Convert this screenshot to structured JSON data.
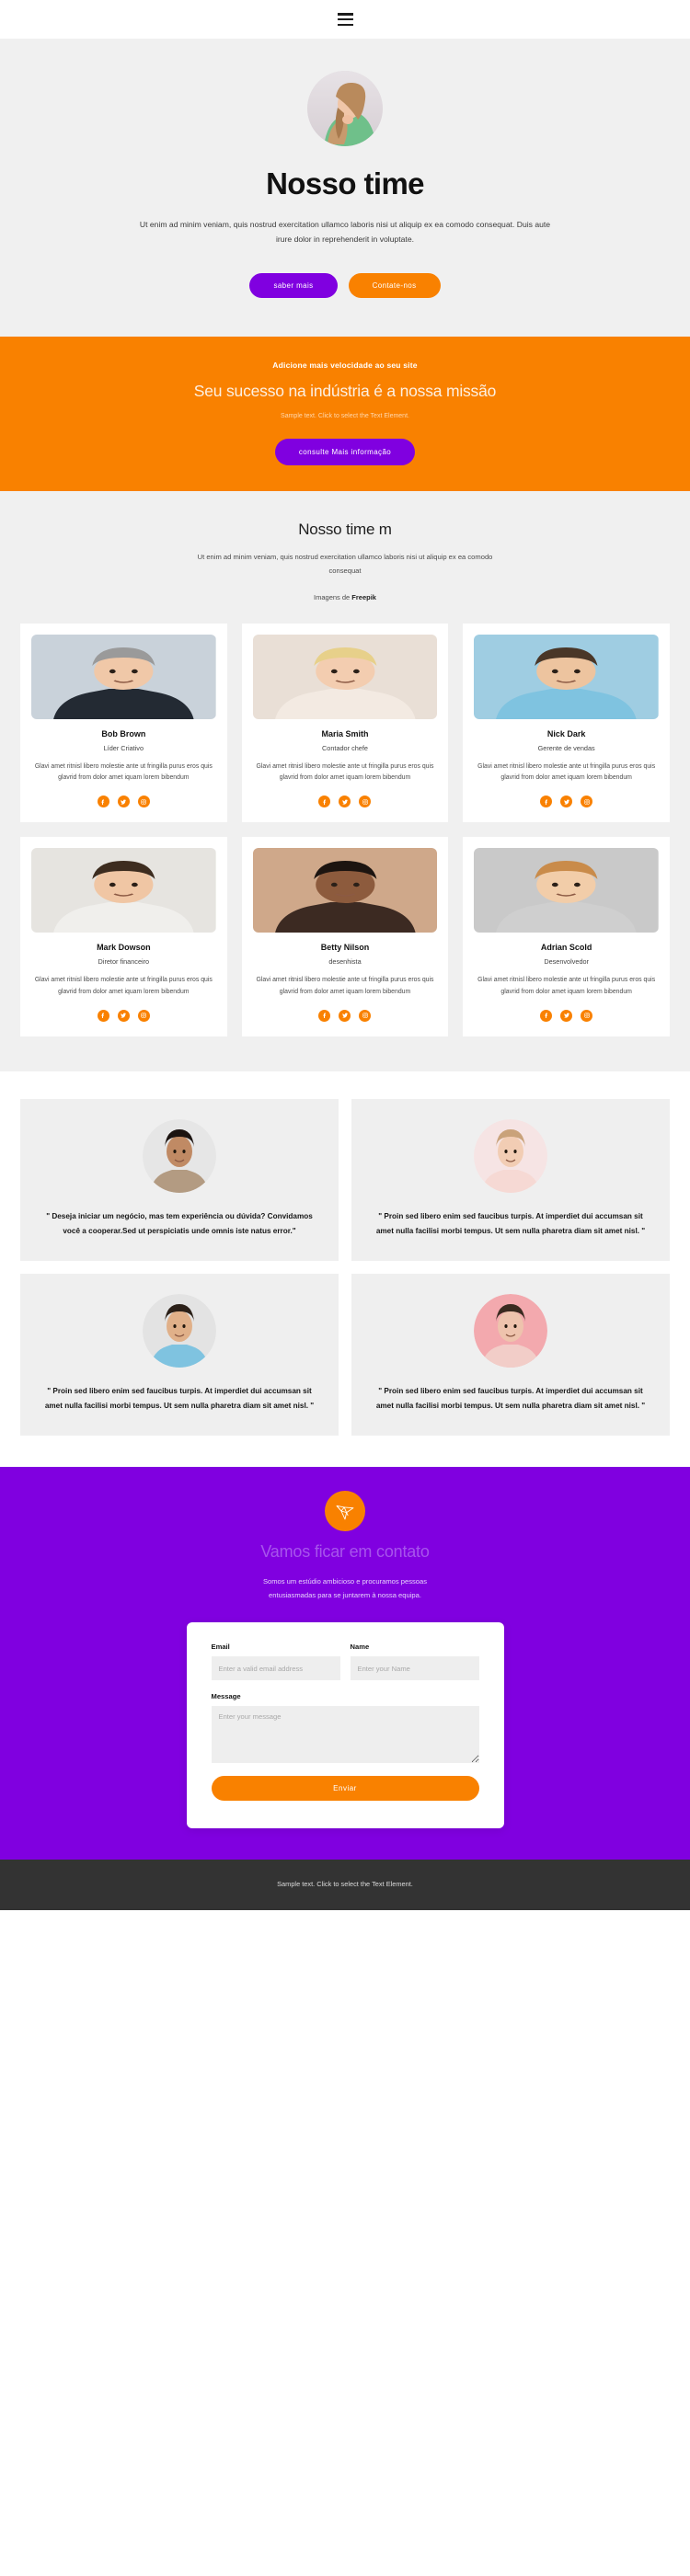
{
  "header": {
    "menu_icon": "hamburger-menu-icon"
  },
  "hero": {
    "avatar_alt": "woman-smiling-portrait",
    "title": "Nosso time",
    "subtitle": "Ut enim ad minim veniam, quis nostrud exercitation ullamco laboris nisi ut aliquip ex ea comodo consequat. Duis aute irure dolor in reprehenderit in voluptate.",
    "primary_button": "saber mais",
    "secondary_button": "Contate-nos"
  },
  "banner": {
    "kicker": "Adicione mais velocidade ao seu site",
    "title": "Seu sucesso na indústria é a nossa missão",
    "text": "Sample text. Click to select the Text Element.",
    "button": "consulte Mais informação"
  },
  "team": {
    "title": "Nosso time m",
    "subtitle": "Ut enim ad minim veniam, quis nostrud exercitation ullamco laboris nisi ut aliquip ex ea comodo consequat",
    "credit_prefix": "Imagens de ",
    "credit_source": "Freepik",
    "bio": "Glavi amet ritnisl libero molestie ante ut fringilla purus eros quis glavrid from dolor amet iquam lorem bibendum",
    "members": [
      {
        "name": "Bob Brown",
        "role": "Líder Criativo",
        "photo_top": "#2f3740",
        "photo_bottom": "#cfd6dc"
      },
      {
        "name": "Maria Smith",
        "role": "Contador chefe",
        "photo_top": "#d8c3b3",
        "photo_bottom": "#e9ded5"
      },
      {
        "name": "Nick Dark",
        "role": "Gerente de vendas",
        "photo_top": "#b9d9e8",
        "photo_bottom": "#8fc4de"
      },
      {
        "name": "Mark Dowson",
        "role": "Diretor financeiro",
        "photo_top": "#d9bda6",
        "photo_bottom": "#e8e6e3"
      },
      {
        "name": "Betty Nilson",
        "role": "desenhista",
        "photo_top": "#3b2a22",
        "photo_bottom": "#c9a98e"
      },
      {
        "name": "Adrian Scold",
        "role": "Desenvolvedor",
        "photo_top": "#c49a73",
        "photo_bottom": "#c9c9c9"
      }
    ],
    "socials": [
      "facebook-icon",
      "twitter-icon",
      "instagram-icon"
    ]
  },
  "testimonials": [
    {
      "avatar_bg": "#e6e6e6",
      "avatar_alt": "curly-hair-woman-portrait",
      "quote": "\" Deseja iniciar um negócio, mas tem experiência ou dúvida? Convidamos você a cooperar.Sed ut perspiciatis unde omnis iste natus error.\""
    },
    {
      "avatar_bg": "#f6e4e4",
      "avatar_alt": "woman-hand-on-face-portrait",
      "quote": "\" Proin sed libero enim sed faucibus turpis. At imperdiet dui accumsan sit amet nulla facilisi morbi tempus. Ut sem nulla pharetra diam sit amet nisl. \""
    },
    {
      "avatar_bg": "#e3e3e3",
      "avatar_alt": "man-arms-crossed-portrait",
      "quote": "\" Proin sed libero enim sed faucibus turpis. At imperdiet dui accumsan sit amet nulla facilisi morbi tempus. Ut sem nulla pharetra diam sit amet nisl. \""
    },
    {
      "avatar_bg": "#f3a9ae",
      "avatar_alt": "woman-pink-background-portrait",
      "quote": "\" Proin sed libero enim sed faucibus turpis. At imperdiet dui accumsan sit amet nulla facilisi morbi tempus. Ut sem nulla pharetra diam sit amet nisl. \""
    }
  ],
  "contact": {
    "logo_icon": "origami-bird-icon",
    "title": "Vamos ficar em contato",
    "subtitle": "Somos um estúdio ambicioso e procuramos pessoas entusiasmadas para se juntarem à nossa equipa.",
    "form": {
      "email_label": "Email",
      "email_placeholder": "Enter a valid email address",
      "name_label": "Name",
      "name_placeholder": "Enter your Name",
      "message_label": "Message",
      "message_placeholder": "Enter your message",
      "submit_label": "Enviar"
    }
  },
  "footer": {
    "text": "Sample text. Click to select the Text Element."
  },
  "colors": {
    "purple": "#8000e0",
    "orange": "#f98100",
    "hero_bg": "#f0f0f0",
    "card_bg": "#ffffff",
    "testi_bg": "#efefef",
    "footer_bg": "#333333"
  }
}
